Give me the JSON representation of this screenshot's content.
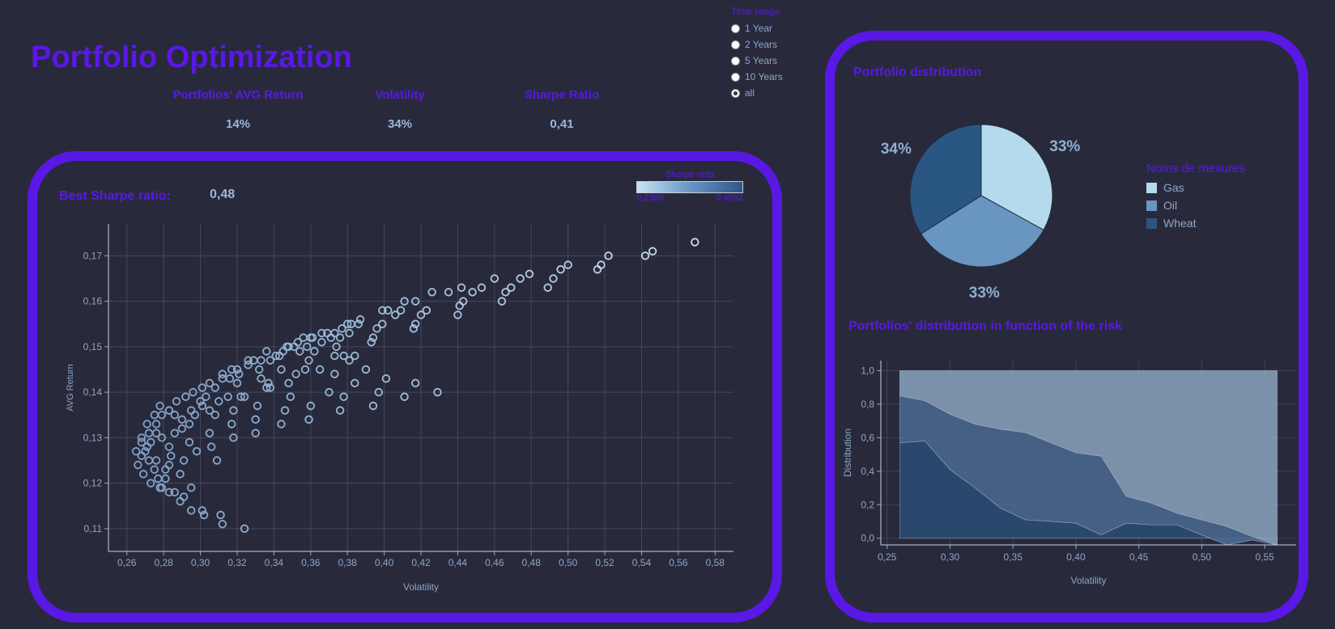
{
  "header": {
    "title": "Portfolio Optimization",
    "kpis": [
      {
        "label": "Portfolios' AVG Return",
        "value": "14%"
      },
      {
        "label": "Volatility",
        "value": "34%"
      },
      {
        "label": "Sharpe Ratio",
        "value": "0,41"
      }
    ]
  },
  "time_range": {
    "title": "Time range",
    "options": [
      "1 Year",
      "2 Years",
      "5 Years",
      "10 Years",
      "all"
    ],
    "selected": "all"
  },
  "left_panel": {
    "best_label": "Best Sharpe ratio:",
    "best_value": "0,48",
    "color_legend": {
      "title": "Sharpe ratio",
      "min": "0,2389",
      "max": "0,4832"
    }
  },
  "right_panel": {
    "pie_title": "Portfolio distribution",
    "pie_legend_title": "Noms de mesures",
    "area_title": "Portfolios' distribution in function of the risk"
  },
  "colors": {
    "accent": "#5a18e6",
    "gas": "#b5daee",
    "oil": "#6896c0",
    "wheat": "#2a5683",
    "background": "#282a3c"
  },
  "chart_data": [
    {
      "type": "scatter",
      "xlabel": "Volatility",
      "ylabel": "AVG Return",
      "xlim": [
        0.25,
        0.59
      ],
      "ylim": [
        0.105,
        0.177
      ],
      "xticks": [
        "0,26",
        "0,28",
        "0,30",
        "0,32",
        "0,34",
        "0,36",
        "0,38",
        "0,40",
        "0,42",
        "0,44",
        "0,46",
        "0,48",
        "0,50",
        "0,52",
        "0,54",
        "0,56",
        "0,58"
      ],
      "yticks": [
        "0,11",
        "0,12",
        "0,13",
        "0,14",
        "0,15",
        "0,16",
        "0,17"
      ],
      "points": [
        [
          0.569,
          0.173
        ],
        [
          0.546,
          0.171
        ],
        [
          0.542,
          0.17
        ],
        [
          0.522,
          0.17
        ],
        [
          0.518,
          0.168
        ],
        [
          0.516,
          0.167
        ],
        [
          0.5,
          0.168
        ],
        [
          0.496,
          0.167
        ],
        [
          0.492,
          0.165
        ],
        [
          0.489,
          0.163
        ],
        [
          0.479,
          0.166
        ],
        [
          0.474,
          0.165
        ],
        [
          0.469,
          0.163
        ],
        [
          0.466,
          0.162
        ],
        [
          0.464,
          0.16
        ],
        [
          0.46,
          0.165
        ],
        [
          0.453,
          0.163
        ],
        [
          0.448,
          0.162
        ],
        [
          0.443,
          0.16
        ],
        [
          0.441,
          0.159
        ],
        [
          0.44,
          0.157
        ],
        [
          0.442,
          0.163
        ],
        [
          0.435,
          0.162
        ],
        [
          0.426,
          0.162
        ],
        [
          0.423,
          0.158
        ],
        [
          0.42,
          0.157
        ],
        [
          0.417,
          0.155
        ],
        [
          0.416,
          0.154
        ],
        [
          0.417,
          0.16
        ],
        [
          0.411,
          0.16
        ],
        [
          0.409,
          0.158
        ],
        [
          0.406,
          0.157
        ],
        [
          0.402,
          0.158
        ],
        [
          0.399,
          0.158
        ],
        [
          0.399,
          0.155
        ],
        [
          0.396,
          0.154
        ],
        [
          0.394,
          0.152
        ],
        [
          0.393,
          0.151
        ],
        [
          0.387,
          0.156
        ],
        [
          0.386,
          0.155
        ],
        [
          0.382,
          0.155
        ],
        [
          0.38,
          0.155
        ],
        [
          0.377,
          0.154
        ],
        [
          0.373,
          0.153
        ],
        [
          0.369,
          0.153
        ],
        [
          0.366,
          0.153
        ],
        [
          0.361,
          0.152
        ],
        [
          0.356,
          0.152
        ],
        [
          0.354,
          0.149
        ],
        [
          0.351,
          0.15
        ],
        [
          0.348,
          0.15
        ],
        [
          0.345,
          0.149
        ],
        [
          0.341,
          0.148
        ],
        [
          0.336,
          0.149
        ],
        [
          0.333,
          0.147
        ],
        [
          0.329,
          0.147
        ],
        [
          0.326,
          0.147
        ],
        [
          0.32,
          0.145
        ],
        [
          0.317,
          0.145
        ],
        [
          0.312,
          0.144
        ],
        [
          0.305,
          0.142
        ],
        [
          0.301,
          0.141
        ],
        [
          0.296,
          0.14
        ],
        [
          0.292,
          0.139
        ],
        [
          0.287,
          0.138
        ],
        [
          0.283,
          0.136
        ],
        [
          0.279,
          0.135
        ],
        [
          0.276,
          0.133
        ],
        [
          0.272,
          0.131
        ],
        [
          0.268,
          0.129
        ],
        [
          0.265,
          0.127
        ],
        [
          0.266,
          0.124
        ],
        [
          0.269,
          0.122
        ],
        [
          0.273,
          0.12
        ],
        [
          0.278,
          0.119
        ],
        [
          0.283,
          0.118
        ],
        [
          0.289,
          0.116
        ],
        [
          0.295,
          0.114
        ],
        [
          0.301,
          0.114
        ],
        [
          0.302,
          0.113
        ],
        [
          0.311,
          0.113
        ],
        [
          0.312,
          0.111
        ],
        [
          0.324,
          0.11
        ],
        [
          0.429,
          0.14
        ],
        [
          0.417,
          0.142
        ],
        [
          0.411,
          0.139
        ],
        [
          0.401,
          0.143
        ],
        [
          0.397,
          0.14
        ],
        [
          0.394,
          0.137
        ],
        [
          0.39,
          0.145
        ],
        [
          0.384,
          0.142
        ],
        [
          0.378,
          0.139
        ],
        [
          0.376,
          0.136
        ],
        [
          0.37,
          0.14
        ],
        [
          0.36,
          0.137
        ],
        [
          0.359,
          0.134
        ],
        [
          0.349,
          0.139
        ],
        [
          0.346,
          0.136
        ],
        [
          0.344,
          0.133
        ],
        [
          0.336,
          0.141
        ],
        [
          0.331,
          0.137
        ],
        [
          0.33,
          0.134
        ],
        [
          0.33,
          0.131
        ],
        [
          0.322,
          0.139
        ],
        [
          0.318,
          0.136
        ],
        [
          0.317,
          0.133
        ],
        [
          0.318,
          0.13
        ],
        [
          0.308,
          0.135
        ],
        [
          0.305,
          0.131
        ],
        [
          0.306,
          0.128
        ],
        [
          0.298,
          0.127
        ],
        [
          0.294,
          0.129
        ],
        [
          0.291,
          0.125
        ],
        [
          0.289,
          0.122
        ],
        [
          0.284,
          0.126
        ],
        [
          0.283,
          0.124
        ],
        [
          0.281,
          0.121
        ],
        [
          0.279,
          0.119
        ],
        [
          0.277,
          0.121
        ],
        [
          0.275,
          0.123
        ],
        [
          0.272,
          0.125
        ],
        [
          0.27,
          0.127
        ],
        [
          0.268,
          0.13
        ],
        [
          0.271,
          0.133
        ],
        [
          0.275,
          0.135
        ],
        [
          0.278,
          0.137
        ],
        [
          0.283,
          0.136
        ],
        [
          0.286,
          0.135
        ],
        [
          0.29,
          0.134
        ],
        [
          0.294,
          0.133
        ],
        [
          0.297,
          0.135
        ],
        [
          0.3,
          0.138
        ],
        [
          0.303,
          0.139
        ],
        [
          0.308,
          0.141
        ],
        [
          0.312,
          0.143
        ],
        [
          0.316,
          0.143
        ],
        [
          0.32,
          0.142
        ],
        [
          0.324,
          0.139
        ],
        [
          0.333,
          0.143
        ],
        [
          0.338,
          0.141
        ],
        [
          0.344,
          0.145
        ],
        [
          0.352,
          0.144
        ],
        [
          0.357,
          0.145
        ],
        [
          0.365,
          0.145
        ],
        [
          0.373,
          0.144
        ],
        [
          0.381,
          0.147
        ],
        [
          0.374,
          0.15
        ],
        [
          0.373,
          0.148
        ],
        [
          0.378,
          0.148
        ],
        [
          0.384,
          0.148
        ],
        [
          0.359,
          0.147
        ],
        [
          0.358,
          0.15
        ],
        [
          0.362,
          0.149
        ],
        [
          0.366,
          0.151
        ],
        [
          0.337,
          0.142
        ],
        [
          0.348,
          0.142
        ],
        [
          0.309,
          0.125
        ],
        [
          0.295,
          0.119
        ],
        [
          0.291,
          0.117
        ],
        [
          0.286,
          0.118
        ],
        [
          0.281,
          0.123
        ],
        [
          0.276,
          0.125
        ],
        [
          0.271,
          0.128
        ],
        [
          0.268,
          0.126
        ],
        [
          0.273,
          0.129
        ],
        [
          0.276,
          0.131
        ],
        [
          0.279,
          0.13
        ],
        [
          0.283,
          0.128
        ],
        [
          0.286,
          0.131
        ],
        [
          0.29,
          0.132
        ],
        [
          0.295,
          0.136
        ],
        [
          0.301,
          0.137
        ],
        [
          0.305,
          0.136
        ],
        [
          0.31,
          0.138
        ],
        [
          0.315,
          0.139
        ],
        [
          0.321,
          0.144
        ],
        [
          0.326,
          0.146
        ],
        [
          0.332,
          0.145
        ],
        [
          0.338,
          0.147
        ],
        [
          0.343,
          0.148
        ],
        [
          0.347,
          0.15
        ],
        [
          0.353,
          0.151
        ],
        [
          0.36,
          0.152
        ],
        [
          0.371,
          0.152
        ],
        [
          0.376,
          0.152
        ],
        [
          0.381,
          0.153
        ]
      ]
    },
    {
      "type": "pie",
      "labels": [
        "Gas",
        "Oil",
        "Wheat"
      ],
      "values": [
        33,
        33,
        34
      ],
      "value_labels": [
        "33%",
        "33%",
        "34%"
      ]
    },
    {
      "type": "area",
      "xlabel": "Volatility",
      "ylabel": "Distribution",
      "xlim": [
        0.245,
        0.575
      ],
      "ylim": [
        -0.04,
        1.06
      ],
      "xticks": [
        "0,25",
        "0,30",
        "0,35",
        "0,40",
        "0,45",
        "0,50",
        "0,55"
      ],
      "yticks": [
        "0,0",
        "0,2",
        "0,4",
        "0,6",
        "0,8",
        "1,0"
      ],
      "x": [
        0.26,
        0.28,
        0.3,
        0.32,
        0.34,
        0.36,
        0.38,
        0.4,
        0.42,
        0.44,
        0.46,
        0.48,
        0.5,
        0.52,
        0.54,
        0.56
      ],
      "series": [
        {
          "name": "Wheat",
          "values": [
            0.57,
            0.58,
            0.41,
            0.3,
            0.18,
            0.11,
            0.1,
            0.09,
            0.02,
            0.09,
            0.08,
            0.08,
            0.02,
            -0.04,
            -0.01,
            -0.04
          ]
        },
        {
          "name": "Oil",
          "values": [
            0.28,
            0.24,
            0.33,
            0.38,
            0.47,
            0.52,
            0.47,
            0.42,
            0.47,
            0.16,
            0.13,
            0.07,
            0.09,
            0.11,
            0.02,
            0.0
          ]
        },
        {
          "name": "Gas",
          "values": [
            0.15,
            0.18,
            0.26,
            0.32,
            0.35,
            0.37,
            0.43,
            0.49,
            0.51,
            0.75,
            0.79,
            0.85,
            0.89,
            0.93,
            0.99,
            1.04
          ]
        }
      ]
    }
  ]
}
